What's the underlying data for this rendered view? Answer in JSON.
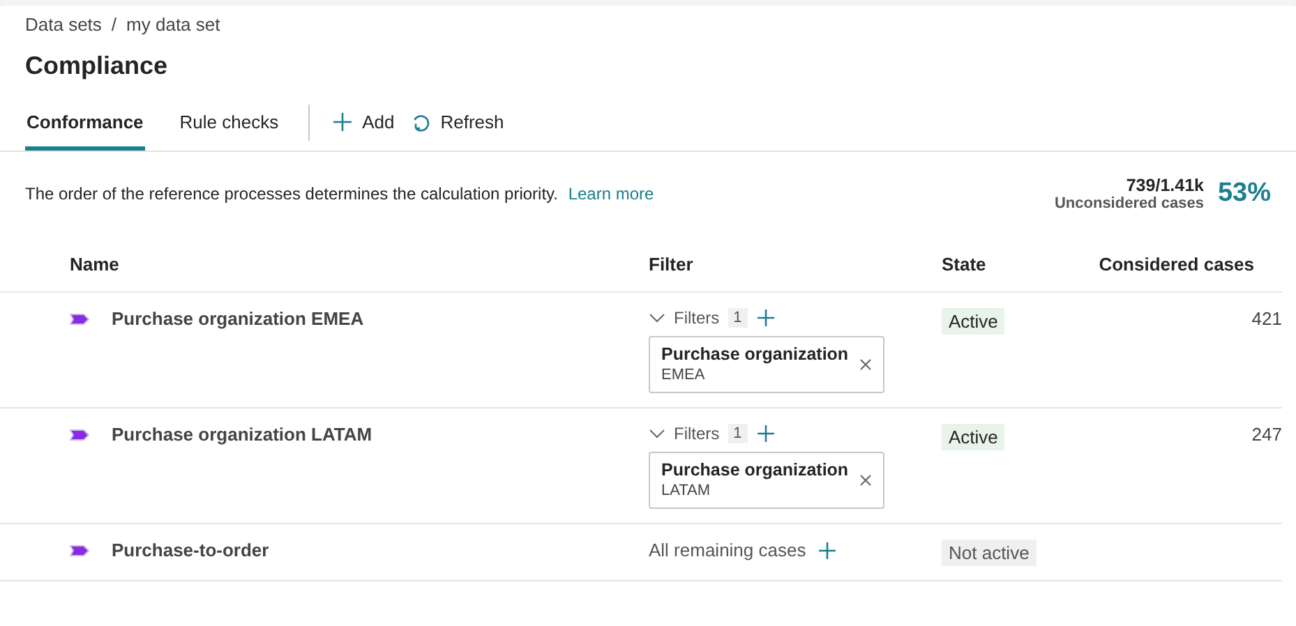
{
  "breadcrumb": [
    "Data sets",
    "my data set"
  ],
  "breadcrumb_separator": "/",
  "title": "Compliance",
  "tabs": [
    {
      "label": "Conformance",
      "selected": true
    },
    {
      "label": "Rule checks",
      "selected": false
    }
  ],
  "toolbar": [
    {
      "kind": "add",
      "label": "Add"
    },
    {
      "kind": "refresh",
      "label": "Refresh"
    }
  ],
  "info": {
    "text": "The order of the reference processes determines the calculation priority.",
    "link": "Learn more"
  },
  "summary": {
    "ratio": "739/1.41k",
    "label": "Unconsidered cases",
    "percent": "53%"
  },
  "table": {
    "columns": [
      "Name",
      "Filter",
      "State",
      "Considered cases"
    ],
    "rows": [
      {
        "name": "Purchase organization EMEA",
        "filter": {
          "kind": "filters",
          "label": "Filters",
          "count": "1",
          "chips": [
            {
              "title": "Purchase organization",
              "value": "EMEA"
            }
          ]
        },
        "state": "Active",
        "active": true,
        "considered": "421"
      },
      {
        "name": "Purchase organization LATAM",
        "filter": {
          "kind": "filters",
          "label": "Filters",
          "count": "1",
          "chips": [
            {
              "title": "Purchase organization",
              "value": "LATAM"
            }
          ]
        },
        "state": "Active",
        "active": true,
        "considered": "247"
      },
      {
        "name": "Purchase-to-order",
        "filter": {
          "kind": "remaining",
          "label": "All remaining cases"
        },
        "state": "Not active",
        "active": false
      }
    ]
  }
}
